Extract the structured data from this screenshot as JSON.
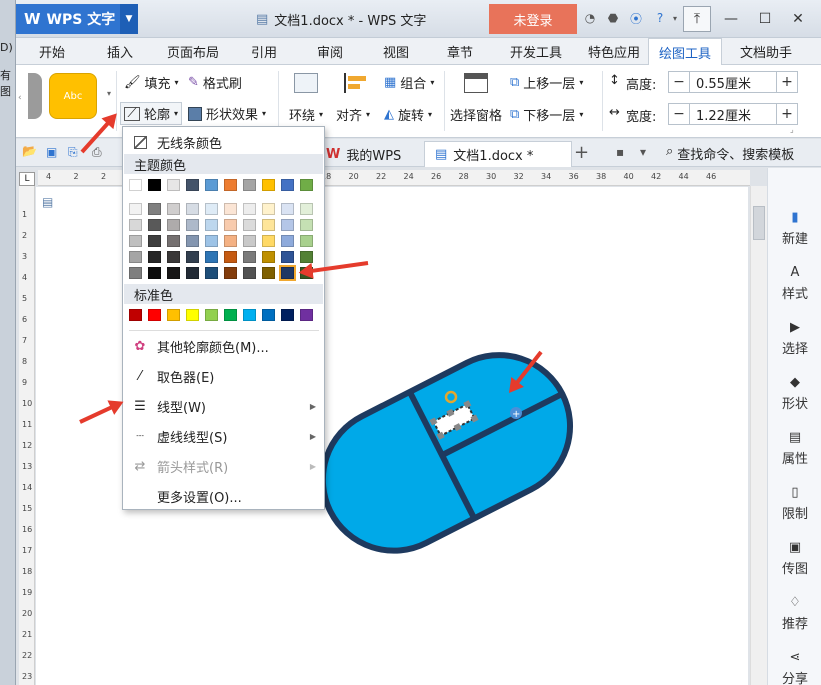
{
  "background_window": {
    "line1": "D)",
    "line2": "有图"
  },
  "titlebar": {
    "app_name": "WPS 文字",
    "doc_title": "文档1.docx * - WPS 文字",
    "login": "未登录"
  },
  "tabs": [
    "开始",
    "插入",
    "页面布局",
    "引用",
    "审阅",
    "视图",
    "章节",
    "开发工具",
    "特色应用",
    "绘图工具",
    "文档助手"
  ],
  "active_tab": "绘图工具",
  "ribbon": {
    "style_preview": "Abc",
    "fill": "填充",
    "format_painter": "格式刷",
    "outline": "轮廓",
    "shape_effect": "形状效果",
    "wrap": "环绕",
    "align": "对齐",
    "group": "组合",
    "rotate": "旋转",
    "selection_pane": "选择窗格",
    "bring_forward": "上移一层",
    "send_backward": "下移一层",
    "height_label": "高度:",
    "height_value": "0.55厘米",
    "width_label": "宽度:",
    "width_value": "1.22厘米",
    "minus": "−",
    "plus": "+"
  },
  "docbar": {
    "my_wps": "我的WPS",
    "doc_tab": "文档1.docx *",
    "add": "+",
    "search": "查找命令、搜索模板"
  },
  "ruler": {
    "h_ticks": [
      "4",
      "2",
      "2",
      "4",
      "6",
      "8",
      "10",
      "12",
      "14",
      "16",
      "18",
      "20",
      "22",
      "24",
      "26",
      "28",
      "30",
      "32",
      "34",
      "36",
      "38",
      "40",
      "42",
      "44",
      "46"
    ],
    "v_ticks": [
      "1",
      "2",
      "3",
      "4",
      "5",
      "6",
      "7",
      "8",
      "9",
      "10",
      "11",
      "12",
      "13",
      "14",
      "15",
      "16",
      "17",
      "18",
      "19",
      "20",
      "21",
      "22",
      "23"
    ]
  },
  "menu": {
    "no_line": "无线条颜色",
    "theme_colors": "主题颜色",
    "standard_colors": "标准色",
    "more_colors": "其他轮廓颜色(M)...",
    "eyedropper": "取色器(E)",
    "line_type": "线型(W)",
    "dash_type": "虚线线型(S)",
    "arrow_style": "箭头样式(R)",
    "more_settings": "更多设置(O)..."
  },
  "theme_color_top": [
    "#ffffff",
    "#000000",
    "#e7e6e6",
    "#44546a",
    "#5b9bd5",
    "#ed7d31",
    "#a5a5a5",
    "#ffc000",
    "#4472c4",
    "#70ad47"
  ],
  "theme_color_rows": [
    [
      "#f2f2f2",
      "#7f7f7f",
      "#d0cece",
      "#d6dce4",
      "#deebf6",
      "#fbe5d5",
      "#ededed",
      "#fff2cc",
      "#dae3f3",
      "#e2efd9"
    ],
    [
      "#d8d8d8",
      "#595959",
      "#aeabab",
      "#adb9ca",
      "#bdd7ee",
      "#f8cbad",
      "#dbdbdb",
      "#fee599",
      "#b4c6e7",
      "#c5e0b3"
    ],
    [
      "#bfbfbf",
      "#3f3f3f",
      "#757070",
      "#8496b0",
      "#9dc3e6",
      "#f4b183",
      "#c9c9c9",
      "#ffd965",
      "#8eaadb",
      "#a8d08d"
    ],
    [
      "#a5a5a5",
      "#262626",
      "#3a3838",
      "#323f4f",
      "#2e75b5",
      "#c55a11",
      "#7b7b7b",
      "#bf9000",
      "#2f5496",
      "#538135"
    ],
    [
      "#7f7f7f",
      "#0c0c0c",
      "#171616",
      "#222a35",
      "#1e4e79",
      "#833c0b",
      "#525252",
      "#7f6000",
      "#1f3864",
      "#375623"
    ]
  ],
  "standard_color_list": [
    "#c00000",
    "#ff0000",
    "#ffc000",
    "#ffff00",
    "#92d050",
    "#00b050",
    "#00b0f0",
    "#0070c0",
    "#002060",
    "#7030a0"
  ],
  "right_panel": [
    "新建",
    "样式",
    "选择",
    "形状",
    "属性",
    "限制",
    "传图",
    "推荐",
    "分享"
  ],
  "colors": {
    "accent": "#2f74d0",
    "login": "#e8735a",
    "mouse_fill": "#00a9e8",
    "mouse_outline": "#1e3a5f",
    "arrow": "#e53b2c"
  }
}
